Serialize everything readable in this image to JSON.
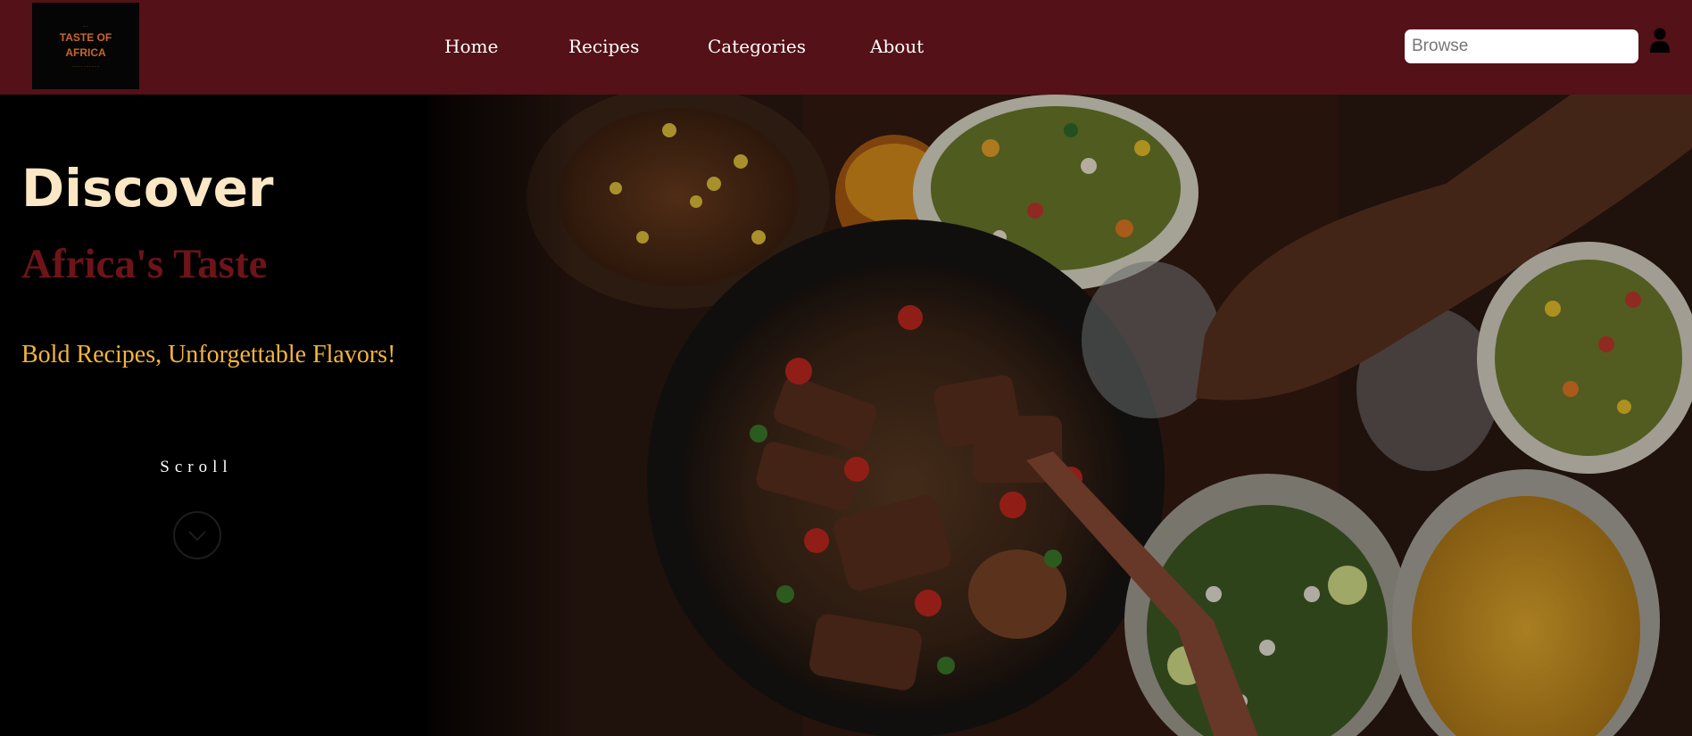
{
  "logo": {
    "small_text": "·····",
    "title_line1": "TASTE OF",
    "title_line2": "AFRICA",
    "tagline": "········ ············"
  },
  "nav": {
    "items": [
      {
        "label": "Home"
      },
      {
        "label": "Recipes"
      },
      {
        "label": "Categories"
      },
      {
        "label": "About"
      }
    ]
  },
  "search": {
    "placeholder": "Browse",
    "value": ""
  },
  "icons": {
    "user": "user-icon",
    "scroll": "chevron-down-icon"
  },
  "hero": {
    "title": "Discover",
    "subtitle": "Africa's Taste",
    "tagline": "Bold Recipes, Unforgettable Flavors!",
    "scroll_label": "Scroll",
    "image_description_icon": "african-food-spread-image"
  },
  "colors": {
    "header_bg": "#541117",
    "title": "#fbe7c4",
    "subtitle": "#6e1419",
    "tagline": "#f4b43b",
    "hero_bg": "#000000"
  }
}
